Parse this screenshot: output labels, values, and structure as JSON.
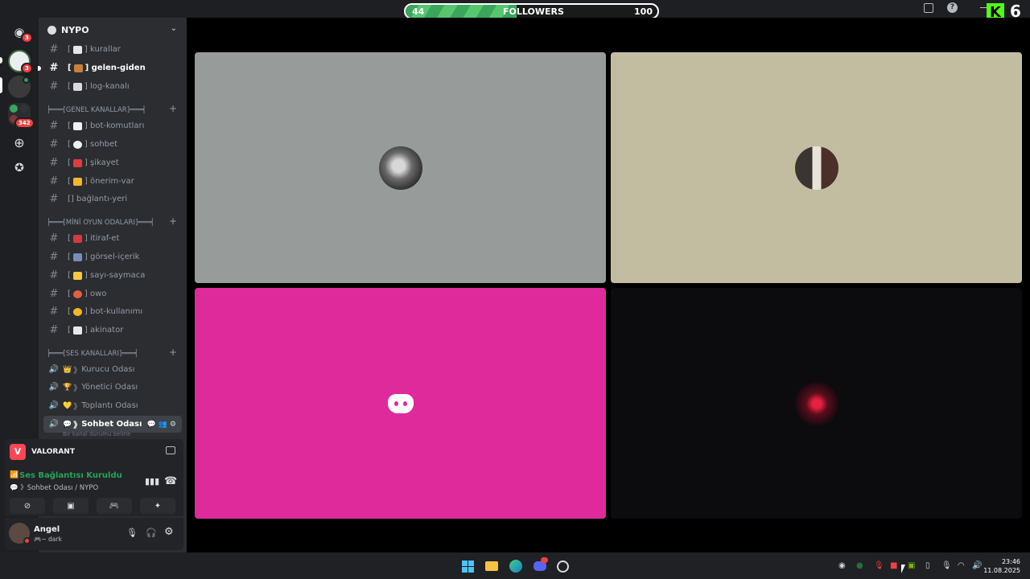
{
  "stream_counter": {
    "current": "44",
    "label": "FOLLOWERS",
    "goal": "100",
    "progress_percent": 44
  },
  "watermark": {
    "letter": "K",
    "number": "6"
  },
  "server": {
    "name": "NYPO"
  },
  "rail_badges": [
    "3",
    "3",
    "342"
  ],
  "channels_top": [
    {
      "emoji_color": "#e6e6e6",
      "label": "kurallar",
      "active": false
    },
    {
      "emoji_color": "#c97f3e",
      "label": "gelen-giden",
      "active": true
    },
    {
      "emoji_color": "#d8d8e0",
      "label": "log-kanalı",
      "active": false
    }
  ],
  "category_general": "╞═══[GENEL KANALLAR]═══╡",
  "channels_general": [
    {
      "emoji_color": "#f0f0f0",
      "label": "bot-komutları"
    },
    {
      "emoji_color": "#f0f0f0",
      "label": "sohbet"
    },
    {
      "emoji_color": "#e03c3c",
      "label": "şikayet"
    },
    {
      "emoji_color": "#f5b52a",
      "label": "önerim-var"
    },
    {
      "emoji_color": "",
      "label": "bağlantı-yeri"
    }
  ],
  "category_games": "╞═══[MİNİ OYUN ODALARI]═══╡",
  "channels_games": [
    {
      "emoji_color": "#d43c3c",
      "label": "itiraf-et"
    },
    {
      "emoji_color": "#7a8db8",
      "label": "görsel-içerik"
    },
    {
      "emoji_color": "#f5c842",
      "label": "sayı-saymaca"
    },
    {
      "emoji_color": "#e06040",
      "label": "owo"
    },
    {
      "emoji_color": "#f5b52a",
      "label": "bot-kullanımı"
    },
    {
      "emoji_color": "#e8e8e8",
      "label": "akinator"
    }
  ],
  "category_voice": "╞═══[SES KANALLARI]═══╡",
  "voice_channels": [
    {
      "emoji": "👑",
      "label": "Kurucu Odası",
      "selected": false
    },
    {
      "emoji": "🏆",
      "label": "Yönetici Odası",
      "selected": false
    },
    {
      "emoji": "💛",
      "label": "Toplantı Odası",
      "selected": false
    },
    {
      "emoji": "💬",
      "label": "Sohbet Odası",
      "selected": true
    }
  ],
  "voice_status_hint": "Bir kanal durumu belirle",
  "activity": {
    "name": "VALORANT"
  },
  "voice_connection": {
    "status": "Ses Bağlantısı Kuruldu",
    "location": "💬 》Sohbet Odası / NYPO"
  },
  "user": {
    "name": "Angel",
    "status": "🎮~ dark"
  },
  "clock": {
    "time": "23:46",
    "date": "11.08.2025"
  },
  "colors": {
    "tile_1": "#979b99",
    "tile_2": "#c2bda0",
    "tile_3": "#df2a9c",
    "tile_4": "#0c0b0e",
    "green": "#23a55a"
  }
}
